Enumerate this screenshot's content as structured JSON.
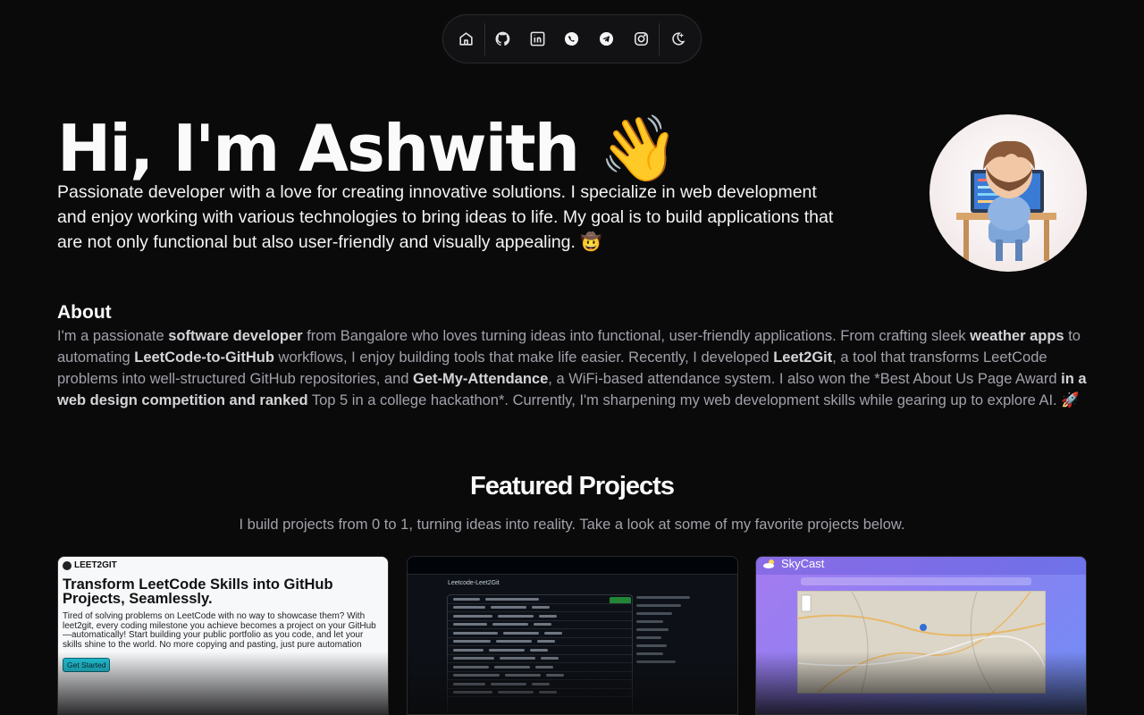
{
  "nav": {
    "items": [
      {
        "name": "home",
        "label": "Home"
      },
      {
        "name": "github",
        "label": "GitHub"
      },
      {
        "name": "linkedin",
        "label": "LinkedIn"
      },
      {
        "name": "whatsapp",
        "label": "WhatsApp"
      },
      {
        "name": "telegram",
        "label": "Telegram"
      },
      {
        "name": "instagram",
        "label": "Instagram"
      },
      {
        "name": "theme-toggle",
        "label": "Toggle theme"
      }
    ]
  },
  "hero": {
    "title": "Hi, I'm Ashwith 👋",
    "description": "Passionate developer with a love for creating innovative solutions. I specialize in web development and enjoy working with various technologies to bring ideas to life. My goal is to build applications that are not only functional but also user-friendly and visually appealing. 🤠"
  },
  "about": {
    "title": "About",
    "p1": "I'm a passionate ",
    "b1": "software developer",
    "p2": " from Bangalore who loves turning ideas into functional, user-friendly applications. From crafting sleek ",
    "b2": "weather apps",
    "p3": " to automating ",
    "b3": "LeetCode-to-GitHub",
    "p4": " workflows, I enjoy building tools that make life easier. Recently, I developed ",
    "b4": "Leet2Git",
    "p5": ", a tool that transforms LeetCode problems into well-structured GitHub repositories, and ",
    "b5": "Get-My-Attendance",
    "p6": ", a WiFi-based attendance system. I also won the *Best About Us Page Award",
    "b6": " in a web design competition and ranked",
    "p7": " Top 5 in a college hackathon*. Currently, I'm sharpening my web development skills while gearing up to explore AI. 🚀"
  },
  "projects": {
    "title": "Featured Projects",
    "subtitle": "I build projects from 0 to 1, turning ideas into reality. Take a look at some of my favorite projects below.",
    "cards": [
      {
        "brand": "LEET2GIT",
        "headline": "Transform LeetCode Skills into GitHub Projects, Seamlessly.",
        "text": "Tired of solving problems on LeetCode with no way to showcase them? With leet2git, every coding milestone you achieve becomes a project on your GitHub—automatically! Start building your public portfolio as you code, and let your skills shine to the world. No more copying and pasting, just pure automation",
        "cta": "Get Started"
      },
      {
        "repo": "Leetcode-Leet2Git"
      },
      {
        "brand": "SkyCast"
      }
    ]
  },
  "colors": {
    "background": "#0a0a0b",
    "text": "#fafafa",
    "muted": "#a1a1aa",
    "accent_cyan": "#21c8dc"
  }
}
